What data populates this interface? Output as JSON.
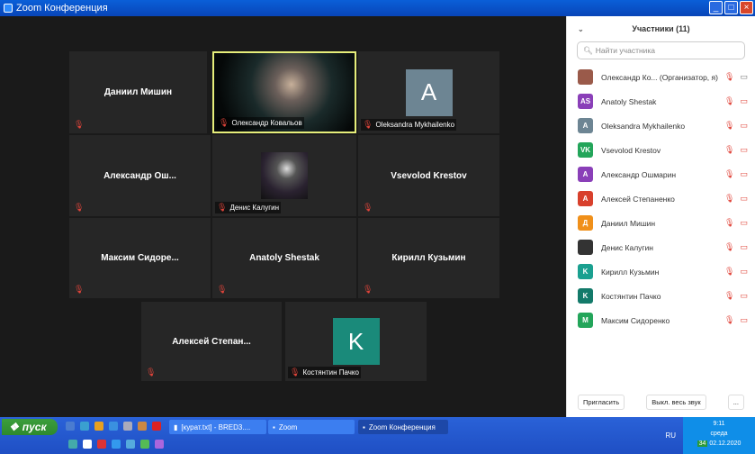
{
  "window": {
    "title": "Zoom Конференция",
    "buttons": [
      "_",
      "□",
      "×"
    ]
  },
  "tiles": [
    {
      "name": "Даниил Мишин",
      "label": "",
      "avatar": null
    },
    {
      "name": "",
      "label": "Олександр Ковальов",
      "video": true
    },
    {
      "name": "",
      "label": "Oleksandra Mykhailenko",
      "avatar": "A",
      "color": "#6d8593"
    },
    {
      "name": "Александр  Ош...",
      "label": ""
    },
    {
      "name": "",
      "label": "Денис Калугин",
      "photo": true
    },
    {
      "name": "Vsevolod Krestov",
      "label": ""
    },
    {
      "name": "Максим  Сидоре...",
      "label": ""
    },
    {
      "name": "Anatoly Shestak",
      "label": ""
    },
    {
      "name": "Кирилл  Кузьмин",
      "label": ""
    },
    {
      "name": "Алексей  Степан...",
      "label": ""
    },
    {
      "name": "",
      "label": "Костянтин Пачко",
      "avatar": "K",
      "color": "#1a8a7a"
    }
  ],
  "panel": {
    "title": "Участники (11)",
    "search_placeholder": "Найти участника",
    "participants": [
      {
        "initials": "",
        "name": "Олександр Ко...  (Организатор, я)",
        "color": "#9a5a4a",
        "video_on": true
      },
      {
        "initials": "AS",
        "name": "Anatoly Shestak",
        "color": "#8a3fb8"
      },
      {
        "initials": "A",
        "name": "Oleksandra Mykhailenko",
        "color": "#6d8593"
      },
      {
        "initials": "VK",
        "name": "Vsevolod Krestov",
        "color": "#23a55a"
      },
      {
        "initials": "A",
        "name": "Александр Ошмарин",
        "color": "#8a3fb8"
      },
      {
        "initials": "A",
        "name": "Алексей Степаненко",
        "color": "#d8402c"
      },
      {
        "initials": "Д",
        "name": "Даниил Мишин",
        "color": "#f0901a"
      },
      {
        "initials": "",
        "name": "Денис Калугин",
        "color": "#333"
      },
      {
        "initials": "K",
        "name": "Кирилл Кузьмин",
        "color": "#1aa090"
      },
      {
        "initials": "K",
        "name": "Костянтин Пачко",
        "color": "#137a6a"
      },
      {
        "initials": "M",
        "name": "Максим Сидоренко",
        "color": "#23a55a"
      }
    ],
    "invite": "Пригласить",
    "mute_all": "Выкл. весь звук",
    "more": "..."
  },
  "taskbar": {
    "start": "пуск",
    "tasks": [
      "[курат.txt] - BRED3....",
      "Zoom",
      "Zoom Конференция"
    ],
    "lang": "RU",
    "time": "9:11",
    "day": "среда",
    "date": "02.12.2020",
    "badge": "34"
  }
}
